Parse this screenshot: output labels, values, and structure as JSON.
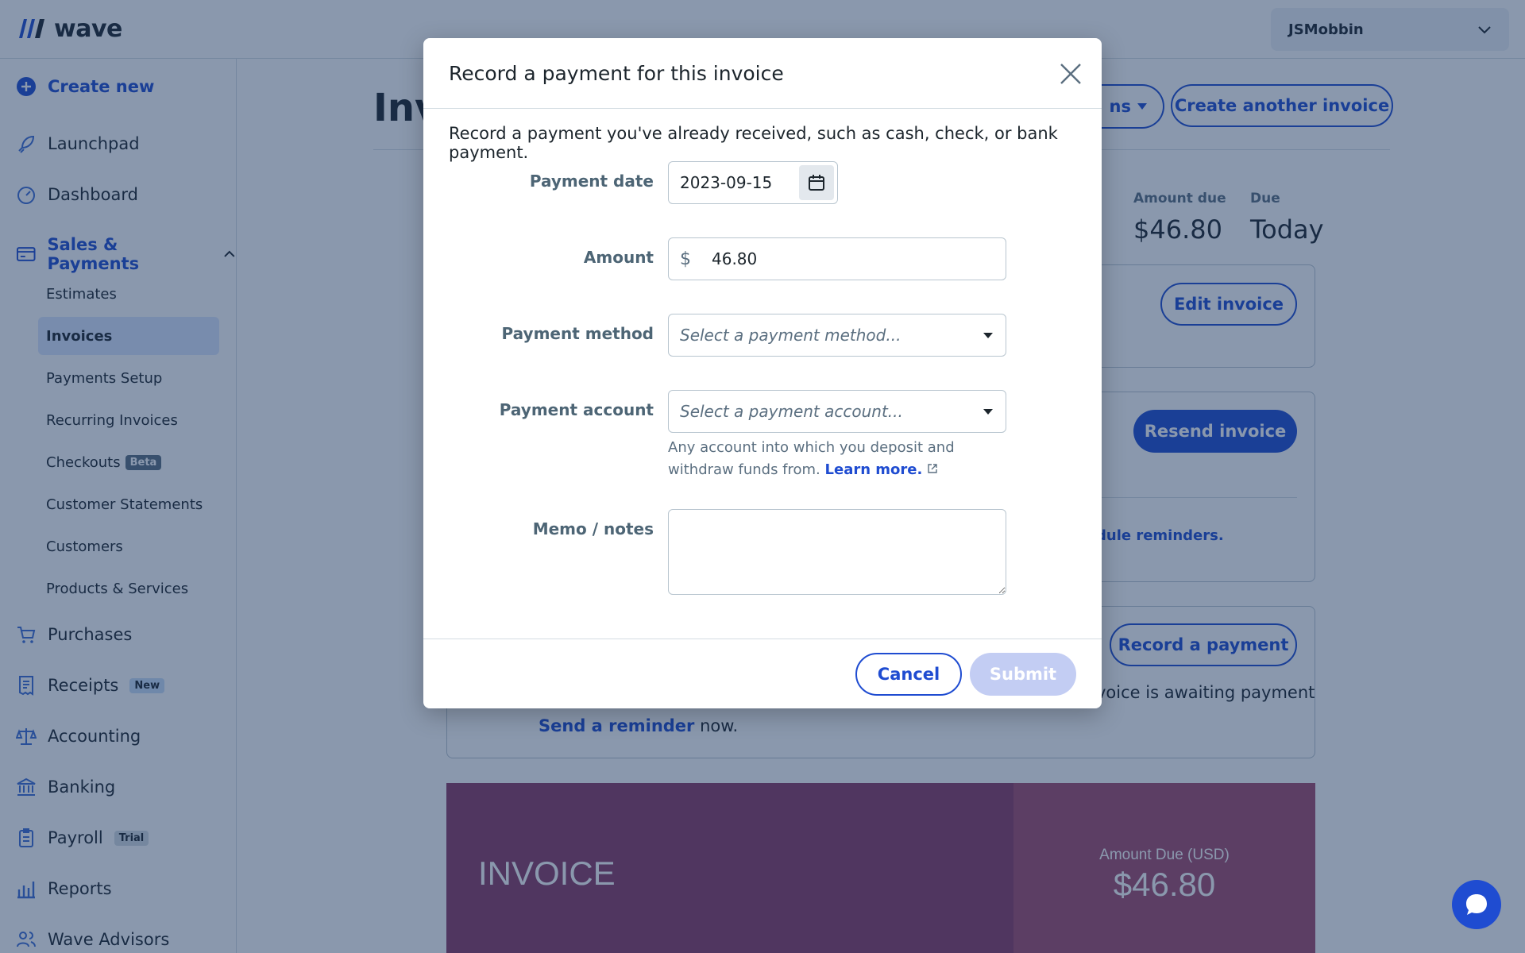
{
  "app": {
    "logo_text": "wave"
  },
  "user_menu": {
    "name": "JSMobbin"
  },
  "sidebar": {
    "create_new": "Create new",
    "launchpad": "Launchpad",
    "dashboard": "Dashboard",
    "sales_payments": "Sales & Payments",
    "sub_items": [
      {
        "label": "Estimates"
      },
      {
        "label": "Invoices"
      },
      {
        "label": "Payments Setup"
      },
      {
        "label": "Recurring Invoices"
      },
      {
        "label": "Checkouts",
        "badge": "Beta"
      },
      {
        "label": "Customer Statements"
      },
      {
        "label": "Customers"
      },
      {
        "label": "Products & Services"
      }
    ],
    "purchases": "Purchases",
    "receipts": "Receipts",
    "receipts_badge": "New",
    "accounting": "Accounting",
    "banking": "Banking",
    "payroll": "Payroll",
    "payroll_badge": "Trial",
    "reports": "Reports",
    "wave_advisors": "Wave Advisors"
  },
  "page": {
    "title_partial": "Inv",
    "more_actions_partial": "ns",
    "create_another": "Create another invoice",
    "amount_due_label": "Amount due",
    "amount_due_value": "$46.80",
    "due_label": "Due",
    "due_value": "Today",
    "edit_invoice": "Edit invoice",
    "resend_invoice": "Resend invoice",
    "schedule_reminders_partial": "dule reminders.",
    "record_payment": "Record a payment",
    "awaiting_partial": "voice is awaiting payment",
    "send_reminder_link": "Send a reminder",
    "send_reminder_rest": " now.",
    "preview": {
      "invoice_word": "INVOICE",
      "amount_due_label": "Amount Due (USD)",
      "amount_due_value": "$46.80"
    }
  },
  "modal": {
    "title": "Record a payment for this invoice",
    "description": "Record a payment you've already received, such as cash, check, or bank payment.",
    "payment_date_label": "Payment date",
    "payment_date_value": "2023-09-15",
    "amount_label": "Amount",
    "currency_symbol": "$",
    "amount_value": "46.80",
    "payment_method_label": "Payment method",
    "payment_method_placeholder": "Select a payment method...",
    "payment_account_label": "Payment account",
    "payment_account_placeholder": "Select a payment account...",
    "helper_text": "Any account into which you deposit and withdraw funds from.",
    "learn_more": "Learn more.",
    "memo_label": "Memo / notes",
    "cancel": "Cancel",
    "submit": "Submit"
  },
  "colors": {
    "primary": "#1f4cd1",
    "overlay": "#16325c",
    "submit_disabled": "#c3cdf3",
    "invoice_preview": "#8a3a64"
  }
}
